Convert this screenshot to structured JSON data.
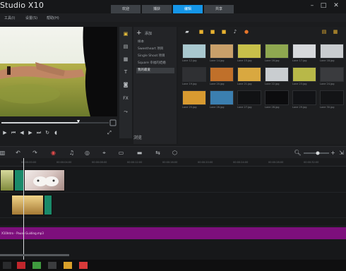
{
  "app": {
    "title": "Studio X10"
  },
  "tabs": [
    {
      "label": "欢迎",
      "active": false
    },
    {
      "label": "捕获",
      "active": false
    },
    {
      "label": "编辑",
      "active": true
    },
    {
      "label": "共享",
      "active": false
    }
  ],
  "menu": [
    "工具(I)",
    "设置(S)",
    "帮助(H)"
  ],
  "library": {
    "add_label": "添加",
    "folders": [
      {
        "label": "样本",
        "selected": false
      },
      {
        "label": "Sweetheart 项目",
        "selected": false
      },
      {
        "label": "Single Shoot 项目",
        "selected": false
      },
      {
        "label": "Square 幸福的结婚",
        "selected": false
      },
      {
        "label": "我的最爱",
        "selected": true
      }
    ],
    "bottom_label": "浏览"
  },
  "media": {
    "thumbnails": [
      {
        "caption": "Lone 12.jpg",
        "color": "#a9c8cf"
      },
      {
        "caption": "Lone 14.jpg",
        "color": "#c9a06a"
      },
      {
        "caption": "Lone 15.jpg",
        "color": "#c7c04a"
      },
      {
        "caption": "Lone 16.jpg",
        "color": "#8fa850"
      },
      {
        "caption": "Lone 17.jpg",
        "color": "#d7d9dc"
      },
      {
        "caption": "Lone 18.jpg",
        "color": "#c9cccf"
      },
      {
        "caption": "Lone 19.jpg",
        "color": "#2f3033"
      },
      {
        "caption": "Lone 20.jpg",
        "color": "#c0702a"
      },
      {
        "caption": "Lone 21.jpg",
        "color": "#d9a840"
      },
      {
        "caption": "Lone 22.jpg",
        "color": "#c9cdd0"
      },
      {
        "caption": "Lone 23.jpg",
        "color": "#b8b848"
      },
      {
        "caption": "Lone 24.jpg",
        "color": "#3a3b3e"
      },
      {
        "caption": "Lone 25.jpg",
        "color": "#d89a30"
      },
      {
        "caption": "Lone 26.jpg",
        "color": "#3b7fb0"
      },
      {
        "caption": "Lone 27.jpg",
        "color": "#111214"
      },
      {
        "caption": "Lone 28.jpg",
        "color": "#0c0c0e"
      },
      {
        "caption": "Lone 29.jpg",
        "color": "#121316"
      },
      {
        "caption": "Lone 30.jpg",
        "color": "#131416"
      }
    ]
  },
  "timeline": {
    "ticks": [
      "00:00:00:00",
      "00:00:04:00",
      "00:00:08:00",
      "00:00:12:00",
      "00:00:16:00",
      "00:00:20:00",
      "00:00:24:00",
      "00:00:28:00",
      "00:00:32:00",
      "00:00:36:00"
    ],
    "audio_clip_label": "X10Intro - Pause Guiding.mp3"
  },
  "colors": {
    "accent": "#1596e8",
    "audio_track": "#7d0f7c",
    "background": "#1b1c1e"
  }
}
